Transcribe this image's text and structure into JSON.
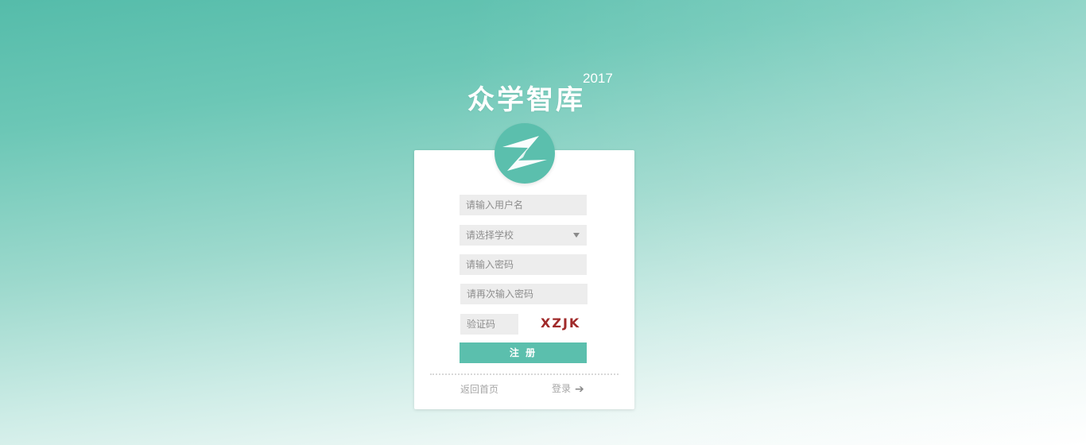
{
  "brand": {
    "title": "众学智库",
    "year": "2017"
  },
  "logo": {
    "icon": "z-logo-icon"
  },
  "form": {
    "username_placeholder": "请输入用户名",
    "school_placeholder": "请选择学校",
    "password_placeholder": "请输入密码",
    "password_confirm_placeholder": "请再次输入密码",
    "captcha_placeholder": "验证码",
    "captcha_code": "XZJK",
    "register_label": "注 册"
  },
  "footer": {
    "home_link": "返回首页",
    "login_link": "登录",
    "login_icon": "arrow-right-icon"
  },
  "colors": {
    "accent": "#5bbfad",
    "captcha_text": "#a02a2a",
    "field_background": "#ededed",
    "placeholder_text": "#8e8e8e"
  }
}
